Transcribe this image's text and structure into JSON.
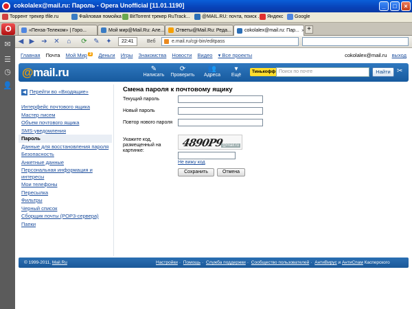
{
  "window": {
    "title": "cokolalex@mail.ru: Пароль - Opera Unofficial [11.01.1190]",
    "minimize": "_",
    "maximize": "□",
    "close": "×"
  },
  "bookmarks": [
    {
      "label": "Торрент трекер tfile.ru",
      "color": "#d04040"
    },
    {
      "label": "Файловая помойка",
      "color": "#3a7cc4"
    },
    {
      "label": "BitTorrent трекер RuTrack...",
      "color": "#6aa84f"
    },
    {
      "label": "@MAIL.RU: почта, поиск ...",
      "color": "#2c6fb6"
    },
    {
      "label": "Яндекс",
      "color": "#e03030"
    },
    {
      "label": "Google",
      "color": "#4f86e0"
    }
  ],
  "tabs": [
    {
      "label": "«Пенза-Телеком» | Горо...",
      "color": "#4f86e0",
      "active": false
    },
    {
      "label": "Мой мир@Mail.Ru: Але...",
      "color": "#3a7cc4",
      "active": false
    },
    {
      "label": "Ответы@Mail.Ru: Реда...",
      "color": "#f6a000",
      "active": false
    },
    {
      "label": "cokolalex@mail.ru: Пар...",
      "color": "#2c6fb6",
      "active": true
    }
  ],
  "toolbar": {
    "time": "22:41",
    "web": "Веб",
    "url": "e.mail.ru/cgi-bin/editpass"
  },
  "topnav": {
    "items": [
      "Главная",
      "Почта",
      "Мой Мир",
      "Деньги",
      "Игры",
      "Знакомства",
      "Новости",
      "Видео",
      "▾ Все проекты"
    ],
    "current_index": 1,
    "badge": "3"
  },
  "user": {
    "email": "cokolalex@mail.ru",
    "exit": "выход"
  },
  "header": {
    "logo_at": "@",
    "logo_text": "mail.ru",
    "buttons": [
      {
        "label": "Написать",
        "icon": "✎"
      },
      {
        "label": "Проверить",
        "icon": "⟳"
      },
      {
        "label": "Адреса",
        "icon": "👥"
      },
      {
        "label": "Ещё",
        "icon": "▾"
      }
    ],
    "ad": "Тинькофф",
    "search_placeholder": "Поиск по почте",
    "search_button": "Найти",
    "settings_icon": "✂"
  },
  "sidebar": {
    "back_link": "Перейти во «Входящие»",
    "items": [
      {
        "label": "Интерфейс почтового ящика",
        "active": false
      },
      {
        "label": "Мастер писем",
        "active": false
      },
      {
        "label": "Объем почтового ящика",
        "active": false
      },
      {
        "label": "SMS-уведомления",
        "active": false
      },
      {
        "label": "Пароль",
        "active": true
      },
      {
        "label": "Данные для восстановления пароля",
        "active": false
      },
      {
        "label": "Безопасность",
        "active": false
      },
      {
        "label": "Анкетные данные",
        "active": false
      },
      {
        "label": "Персональная информация и интересы",
        "active": false
      },
      {
        "label": "Мои телефоны",
        "active": false
      },
      {
        "label": "Пересылка",
        "active": false
      },
      {
        "label": "Фильтры",
        "active": false
      },
      {
        "label": "Черный список",
        "active": false
      },
      {
        "label": "Сборщик почты (POP3-сервера)",
        "active": false
      },
      {
        "label": "Папки",
        "active": false
      }
    ]
  },
  "form": {
    "title": "Смена пароля к почтовому ящику",
    "current_label": "Текущий пароль",
    "new_label": "Новый пароль",
    "repeat_label": "Повтор нового пароля",
    "captcha_label": "Укажите код, размещенный на картинке:",
    "captcha_text": "4890P9",
    "captcha_mark": "@mail.ru",
    "cant_see": "Не вижу код",
    "save": "Сохранить",
    "cancel": "Отмена"
  },
  "footer": {
    "copyright": "© 1999-2011,",
    "brand": "Mail.Ru",
    "links": [
      "Настройки",
      "Помощь",
      "Служба поддержки",
      "Сообщество пользователей",
      "АнтиВирус",
      "АнтиСпам"
    ],
    "suffix": "Касперского"
  }
}
